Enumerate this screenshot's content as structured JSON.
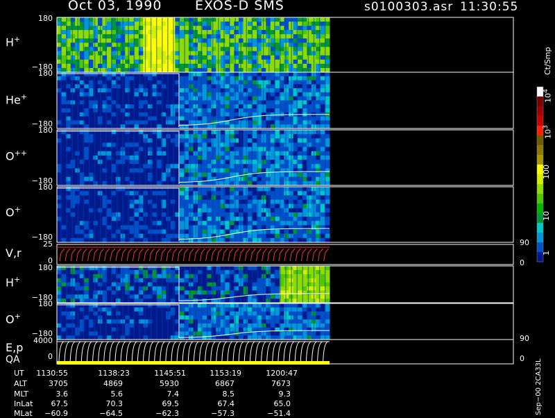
{
  "header": {
    "date": "Oct 03, 1990",
    "instrument": "EXOS-D SMS",
    "file": "s0100303.asr",
    "time": "11:30:55"
  },
  "panels": [
    {
      "id": "h_plus",
      "label": "H",
      "sup": "+",
      "top_tick": "180",
      "bottom_tick": "−180"
    },
    {
      "id": "he_plus",
      "label": "He",
      "sup": "+",
      "top_tick": "180",
      "bottom_tick": "−180"
    },
    {
      "id": "o_plusplus",
      "label": "O",
      "sup": "++",
      "top_tick": "180",
      "bottom_tick": "−180"
    },
    {
      "id": "o_plus",
      "label": "O",
      "sup": "+",
      "top_tick": "180",
      "bottom_tick": "−180"
    },
    {
      "id": "vr",
      "label": "V,r",
      "sup": "",
      "top_tick": "25",
      "bottom_tick": "0",
      "right_top": "90",
      "right_bottom": "0"
    },
    {
      "id": "h_plus_2",
      "label": "H",
      "sup": "+",
      "top_tick": "180",
      "bottom_tick": "−180"
    },
    {
      "id": "o_plus_2",
      "label": "O",
      "sup": "+",
      "top_tick": "180",
      "bottom_tick": "−180"
    },
    {
      "id": "ep_qa",
      "label": "E,p",
      "label2": "QA",
      "sup": "",
      "top_tick": "4000",
      "bottom_tick": "0",
      "right_top": "90",
      "right_bottom": "0"
    }
  ],
  "colorbar": {
    "unit": "Ct/Smp",
    "ticks": [
      "10",
      "10",
      "10",
      "100",
      "10",
      "1"
    ],
    "tick_sup": [
      "4",
      "3",
      "",
      "",
      "",
      ""
    ],
    "colors": [
      "#ffffff",
      "#7a0000",
      "#a00000",
      "#c80000",
      "#ff2000",
      "#6e5a00",
      "#8c7800",
      "#aa9600",
      "#ffff00",
      "#d2f000",
      "#8cdc00",
      "#50c800",
      "#00b400",
      "#009632",
      "#00c8c8",
      "#0096dc",
      "#0050c8",
      "#001a8c"
    ]
  },
  "footer_stamp": "Sep−00  2CA33L",
  "info_table": {
    "rows": [
      {
        "label": "UT",
        "values": [
          "1130:55",
          "1138:23",
          "1145:51",
          "1153:19",
          "1200:47"
        ]
      },
      {
        "label": "ALT",
        "values": [
          "3705",
          "4869",
          "5930",
          "6867",
          "7673"
        ]
      },
      {
        "label": "MLT",
        "values": [
          "3.6",
          "5.6",
          "7.4",
          "8.5",
          "9.3"
        ]
      },
      {
        "label": "InLat",
        "values": [
          "67.5",
          "70.3",
          "69.5",
          "67.4",
          "65.0"
        ]
      },
      {
        "label": "MLat",
        "values": [
          "−60.9",
          "−64.5",
          "−62.3",
          "−57.3",
          "−51.4"
        ]
      }
    ]
  },
  "chart_data": {
    "type": "heatmap",
    "title": "Oct 03, 1990   EXOS-D SMS",
    "x_axis": "UT",
    "x_ticks": [
      "1130:55",
      "1138:23",
      "1145:51",
      "1153:19",
      "1200:47"
    ],
    "y_range_pitch_angle": [
      -180,
      180
    ],
    "colorscale": "log",
    "color_range": [
      1,
      10000
    ],
    "series": [
      {
        "name": "H+",
        "dominant_level": "high (green/yellow)"
      },
      {
        "name": "He+",
        "dominant_level": "low (blue)"
      },
      {
        "name": "O++",
        "dominant_level": "low (blue)"
      },
      {
        "name": "O+",
        "dominant_level": "low (blue)"
      },
      {
        "name": "V,r",
        "y_range": [
          0,
          25
        ]
      },
      {
        "name": "H+",
        "dominant_level": "rising to green late"
      },
      {
        "name": "O+",
        "dominant_level": "low (blue)"
      },
      {
        "name": "E,p",
        "y_range": [
          0,
          4000
        ]
      }
    ]
  }
}
